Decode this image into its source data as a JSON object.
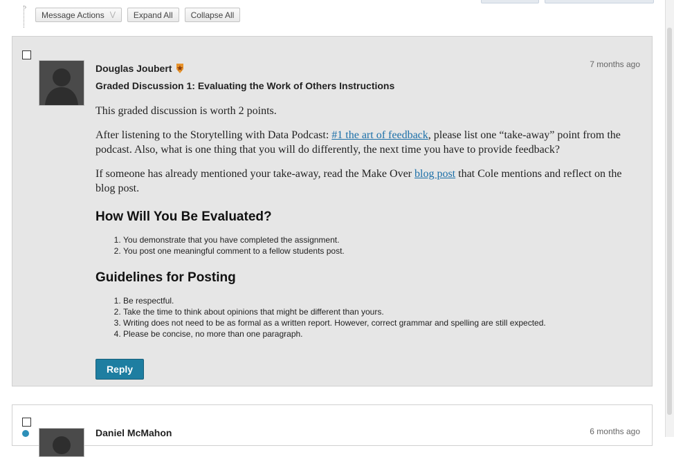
{
  "toolbar": {
    "message_actions": "Message Actions",
    "expand_all": "Expand All",
    "collapse_all": "Collapse All"
  },
  "post": {
    "author": "Douglas Joubert",
    "timestamp": "7 months ago",
    "subject": "Graded Discussion 1: Evaluating the Work of Others Instructions",
    "para1": "This graded discussion is worth 2 points.",
    "para2_before": "After listening to the Storytelling with Data Podcast: ",
    "para2_link": "#1 the art of feedback",
    "para2_after": ", please list one “take-away” point from the podcast. Also, what is one thing that you will do differently, the next time you have to provide feedback?",
    "para3_before": "If someone has already mentioned your take-away, read the Make Over ",
    "para3_link": "blog post",
    "para3_after": " that Cole mentions and reflect on the blog post.",
    "heading1": "How Will You Be Evaluated?",
    "list1": [
      "You demonstrate that you have completed the assignment.",
      "You post one meaningful comment to a fellow students post."
    ],
    "heading2": "Guidelines for Posting",
    "list2": [
      "Be respectful.",
      "Take the time to think about opinions that might be different than yours.",
      "Writing does not need to be as formal as a written report. However, correct grammar and spelling are still expected.",
      "Please be concise, no more than one paragraph."
    ],
    "reply_label": "Reply",
    "badge_icon": "star-badge-icon"
  },
  "post2": {
    "author": "Daniel McMahon",
    "timestamp": "6 months ago"
  },
  "colors": {
    "accent": "#1e7ea1",
    "link": "#1b6fa8",
    "post_bg": "#e6e6e6"
  }
}
